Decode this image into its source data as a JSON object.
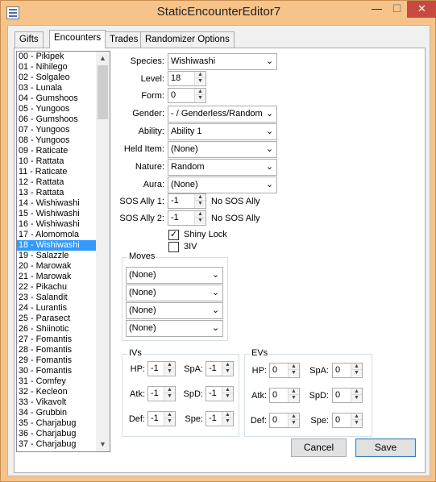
{
  "window": {
    "title": "StaticEncounterEditor7"
  },
  "tabs": [
    "Gifts",
    "Encounters",
    "Trades",
    "Randomizer Options"
  ],
  "encounter_list": {
    "items": [
      "00 - Pikipek",
      "01 - Nihilego",
      "02 - Solgaleo",
      "03 - Lunala",
      "04 - Gumshoos",
      "05 - Yungoos",
      "06 - Gumshoos",
      "07 - Yungoos",
      "08 - Yungoos",
      "09 - Raticate",
      "10 - Rattata",
      "11 - Raticate",
      "12 - Rattata",
      "13 - Rattata",
      "14 - Wishiwashi",
      "15 - Wishiwashi",
      "16 - Wishiwashi",
      "17 - Alomomola",
      "18 - Wishiwashi",
      "19 - Salazzle",
      "20 - Marowak",
      "21 - Marowak",
      "22 - Pikachu",
      "23 - Salandit",
      "24 - Lurantis",
      "25 - Parasect",
      "26 - Shiinotic",
      "27 - Fomantis",
      "28 - Fomantis",
      "29 - Fomantis",
      "30 - Fomantis",
      "31 - Comfey",
      "32 - Kecleon",
      "33 - Vikavolt",
      "34 - Grubbin",
      "35 - Charjabug",
      "36 - Charjabug",
      "37 - Charjabug"
    ],
    "selected": "18 - Wishiwashi"
  },
  "fields": {
    "species": {
      "label": "Species:",
      "value": "Wishiwashi"
    },
    "level": {
      "label": "Level:",
      "value": "18"
    },
    "form": {
      "label": "Form:",
      "value": "0"
    },
    "gender": {
      "label": "Gender:",
      "value": "- / Genderless/Random"
    },
    "ability": {
      "label": "Ability:",
      "value": "Ability 1"
    },
    "held_item": {
      "label": "Held Item:",
      "value": "(None)"
    },
    "nature": {
      "label": "Nature:",
      "value": "Random"
    },
    "aura": {
      "label": "Aura:",
      "value": "(None)"
    },
    "sos1": {
      "label": "SOS Ally 1:",
      "value": "-1",
      "desc": "No SOS Ally"
    },
    "sos2": {
      "label": "SOS Ally 2:",
      "value": "-1",
      "desc": "No SOS Ally"
    }
  },
  "checkboxes": {
    "shiny_lock": {
      "label": "Shiny Lock",
      "checked": true,
      "mark": "✓"
    },
    "three_iv": {
      "label": "3IV",
      "checked": false,
      "mark": ""
    }
  },
  "moves": {
    "title": "Moves",
    "values": [
      "(None)",
      "(None)",
      "(None)",
      "(None)"
    ]
  },
  "ivs": {
    "title": "IVs",
    "hp": {
      "label": "HP:",
      "value": "-1"
    },
    "atk": {
      "label": "Atk:",
      "value": "-1"
    },
    "def": {
      "label": "Def:",
      "value": "-1"
    },
    "spa": {
      "label": "SpA:",
      "value": "-1"
    },
    "spd": {
      "label": "SpD:",
      "value": "-1"
    },
    "spe": {
      "label": "Spe:",
      "value": "-1"
    }
  },
  "evs": {
    "title": "EVs",
    "hp": {
      "label": "HP:",
      "value": "0"
    },
    "atk": {
      "label": "Atk:",
      "value": "0"
    },
    "def": {
      "label": "Def:",
      "value": "0"
    },
    "spa": {
      "label": "SpA:",
      "value": "0"
    },
    "spd": {
      "label": "SpD:",
      "value": "0"
    },
    "spe": {
      "label": "Spe:",
      "value": "0"
    }
  },
  "buttons": {
    "cancel": "Cancel",
    "save": "Save"
  },
  "colors": {
    "selection": "#3399ff",
    "close_button": "#c7493f",
    "frame": "#f6c48a"
  }
}
